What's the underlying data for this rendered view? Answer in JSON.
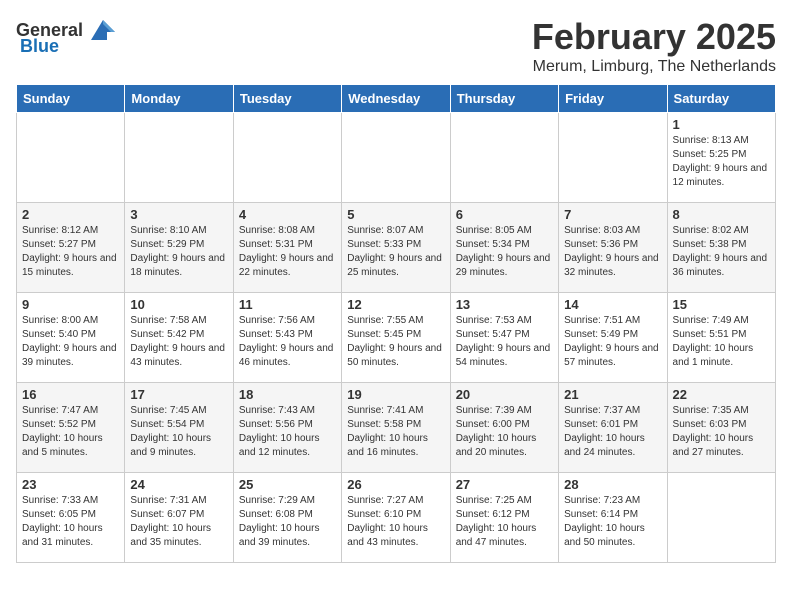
{
  "header": {
    "logo_general": "General",
    "logo_blue": "Blue",
    "title": "February 2025",
    "subtitle": "Merum, Limburg, The Netherlands"
  },
  "days_of_week": [
    "Sunday",
    "Monday",
    "Tuesday",
    "Wednesday",
    "Thursday",
    "Friday",
    "Saturday"
  ],
  "weeks": [
    {
      "days": [
        {
          "number": "",
          "info": ""
        },
        {
          "number": "",
          "info": ""
        },
        {
          "number": "",
          "info": ""
        },
        {
          "number": "",
          "info": ""
        },
        {
          "number": "",
          "info": ""
        },
        {
          "number": "",
          "info": ""
        },
        {
          "number": "1",
          "info": "Sunrise: 8:13 AM\nSunset: 5:25 PM\nDaylight: 9 hours and 12 minutes."
        }
      ]
    },
    {
      "days": [
        {
          "number": "2",
          "info": "Sunrise: 8:12 AM\nSunset: 5:27 PM\nDaylight: 9 hours and 15 minutes."
        },
        {
          "number": "3",
          "info": "Sunrise: 8:10 AM\nSunset: 5:29 PM\nDaylight: 9 hours and 18 minutes."
        },
        {
          "number": "4",
          "info": "Sunrise: 8:08 AM\nSunset: 5:31 PM\nDaylight: 9 hours and 22 minutes."
        },
        {
          "number": "5",
          "info": "Sunrise: 8:07 AM\nSunset: 5:33 PM\nDaylight: 9 hours and 25 minutes."
        },
        {
          "number": "6",
          "info": "Sunrise: 8:05 AM\nSunset: 5:34 PM\nDaylight: 9 hours and 29 minutes."
        },
        {
          "number": "7",
          "info": "Sunrise: 8:03 AM\nSunset: 5:36 PM\nDaylight: 9 hours and 32 minutes."
        },
        {
          "number": "8",
          "info": "Sunrise: 8:02 AM\nSunset: 5:38 PM\nDaylight: 9 hours and 36 minutes."
        }
      ]
    },
    {
      "days": [
        {
          "number": "9",
          "info": "Sunrise: 8:00 AM\nSunset: 5:40 PM\nDaylight: 9 hours and 39 minutes."
        },
        {
          "number": "10",
          "info": "Sunrise: 7:58 AM\nSunset: 5:42 PM\nDaylight: 9 hours and 43 minutes."
        },
        {
          "number": "11",
          "info": "Sunrise: 7:56 AM\nSunset: 5:43 PM\nDaylight: 9 hours and 46 minutes."
        },
        {
          "number": "12",
          "info": "Sunrise: 7:55 AM\nSunset: 5:45 PM\nDaylight: 9 hours and 50 minutes."
        },
        {
          "number": "13",
          "info": "Sunrise: 7:53 AM\nSunset: 5:47 PM\nDaylight: 9 hours and 54 minutes."
        },
        {
          "number": "14",
          "info": "Sunrise: 7:51 AM\nSunset: 5:49 PM\nDaylight: 9 hours and 57 minutes."
        },
        {
          "number": "15",
          "info": "Sunrise: 7:49 AM\nSunset: 5:51 PM\nDaylight: 10 hours and 1 minute."
        }
      ]
    },
    {
      "days": [
        {
          "number": "16",
          "info": "Sunrise: 7:47 AM\nSunset: 5:52 PM\nDaylight: 10 hours and 5 minutes."
        },
        {
          "number": "17",
          "info": "Sunrise: 7:45 AM\nSunset: 5:54 PM\nDaylight: 10 hours and 9 minutes."
        },
        {
          "number": "18",
          "info": "Sunrise: 7:43 AM\nSunset: 5:56 PM\nDaylight: 10 hours and 12 minutes."
        },
        {
          "number": "19",
          "info": "Sunrise: 7:41 AM\nSunset: 5:58 PM\nDaylight: 10 hours and 16 minutes."
        },
        {
          "number": "20",
          "info": "Sunrise: 7:39 AM\nSunset: 6:00 PM\nDaylight: 10 hours and 20 minutes."
        },
        {
          "number": "21",
          "info": "Sunrise: 7:37 AM\nSunset: 6:01 PM\nDaylight: 10 hours and 24 minutes."
        },
        {
          "number": "22",
          "info": "Sunrise: 7:35 AM\nSunset: 6:03 PM\nDaylight: 10 hours and 27 minutes."
        }
      ]
    },
    {
      "days": [
        {
          "number": "23",
          "info": "Sunrise: 7:33 AM\nSunset: 6:05 PM\nDaylight: 10 hours and 31 minutes."
        },
        {
          "number": "24",
          "info": "Sunrise: 7:31 AM\nSunset: 6:07 PM\nDaylight: 10 hours and 35 minutes."
        },
        {
          "number": "25",
          "info": "Sunrise: 7:29 AM\nSunset: 6:08 PM\nDaylight: 10 hours and 39 minutes."
        },
        {
          "number": "26",
          "info": "Sunrise: 7:27 AM\nSunset: 6:10 PM\nDaylight: 10 hours and 43 minutes."
        },
        {
          "number": "27",
          "info": "Sunrise: 7:25 AM\nSunset: 6:12 PM\nDaylight: 10 hours and 47 minutes."
        },
        {
          "number": "28",
          "info": "Sunrise: 7:23 AM\nSunset: 6:14 PM\nDaylight: 10 hours and 50 minutes."
        },
        {
          "number": "",
          "info": ""
        }
      ]
    }
  ]
}
